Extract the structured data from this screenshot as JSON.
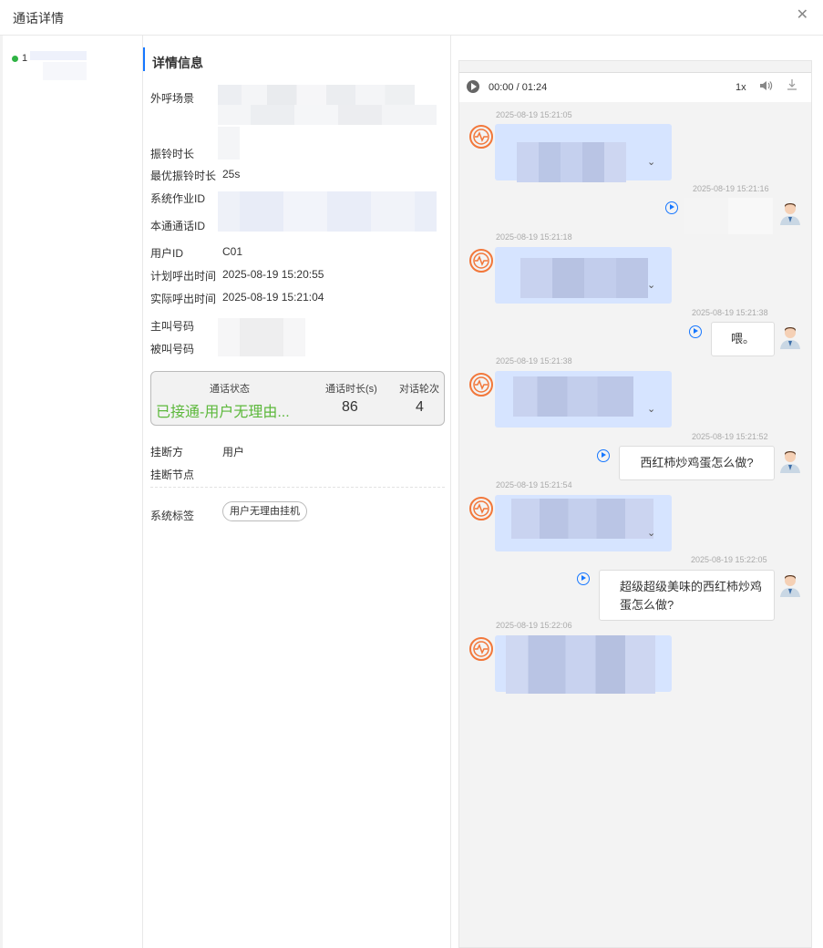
{
  "window": {
    "title": "通话详情",
    "close_icon": "close-icon"
  },
  "left_list": {
    "items": [
      {
        "label": "1",
        "status_color": "#2fb344"
      }
    ]
  },
  "details": {
    "section_title": "详情信息",
    "labels": {
      "scene": "外呼场景",
      "ring_duration": "振铃时长",
      "best_ring_duration": "最优振铃时长",
      "system_job_id": "系统作业ID",
      "call_id": "本通通话ID",
      "user_id": "用户ID",
      "planned_time": "计划呼出时间",
      "actual_time": "实际呼出时间",
      "caller": "主叫号码",
      "callee": "被叫号码",
      "hangup_by": "挂断方",
      "hangup_node": "挂断节点",
      "system_tags": "系统标签"
    },
    "values": {
      "best_ring_duration": "25s",
      "user_id": "C01",
      "planned_time": "2025-08-19 15:20:55",
      "actual_time": "2025-08-19 15:21:04",
      "hangup_by": "用户"
    },
    "summary": {
      "status_label": "通话状态",
      "status_value": "已接通-用户无理由...",
      "status_color": "#5cb83b",
      "duration_label": "通话时长(s)",
      "duration_value": "86",
      "turns_label": "对话轮次",
      "turns_value": "4"
    },
    "tag": "用户无理由挂机"
  },
  "player": {
    "time": "00:00 / 01:24",
    "speed": "1x",
    "volume_icon": "volume-icon",
    "download_icon": "download-icon",
    "play_icon": "play-icon"
  },
  "chat": {
    "accent": "#1677ff",
    "bot_bubble_color": "#d6e4ff",
    "messages": [
      {
        "role": "bot",
        "time": "2025-08-19 15:21:05"
      },
      {
        "role": "user",
        "time": "2025-08-19 15:21:16",
        "text": ""
      },
      {
        "role": "bot",
        "time": "2025-08-19 15:21:18"
      },
      {
        "role": "user",
        "time": "2025-08-19 15:21:38",
        "text": "喂。"
      },
      {
        "role": "bot",
        "time": "2025-08-19 15:21:38"
      },
      {
        "role": "user",
        "time": "2025-08-19 15:21:52",
        "text": "西红柿炒鸡蛋怎么做?"
      },
      {
        "role": "bot",
        "time": "2025-08-19 15:21:54"
      },
      {
        "role": "user",
        "time": "2025-08-19 15:22:05",
        "text": "超级超级美味的西红柿炒鸡蛋怎么做?"
      },
      {
        "role": "bot",
        "time": "2025-08-19 15:22:06"
      }
    ]
  }
}
